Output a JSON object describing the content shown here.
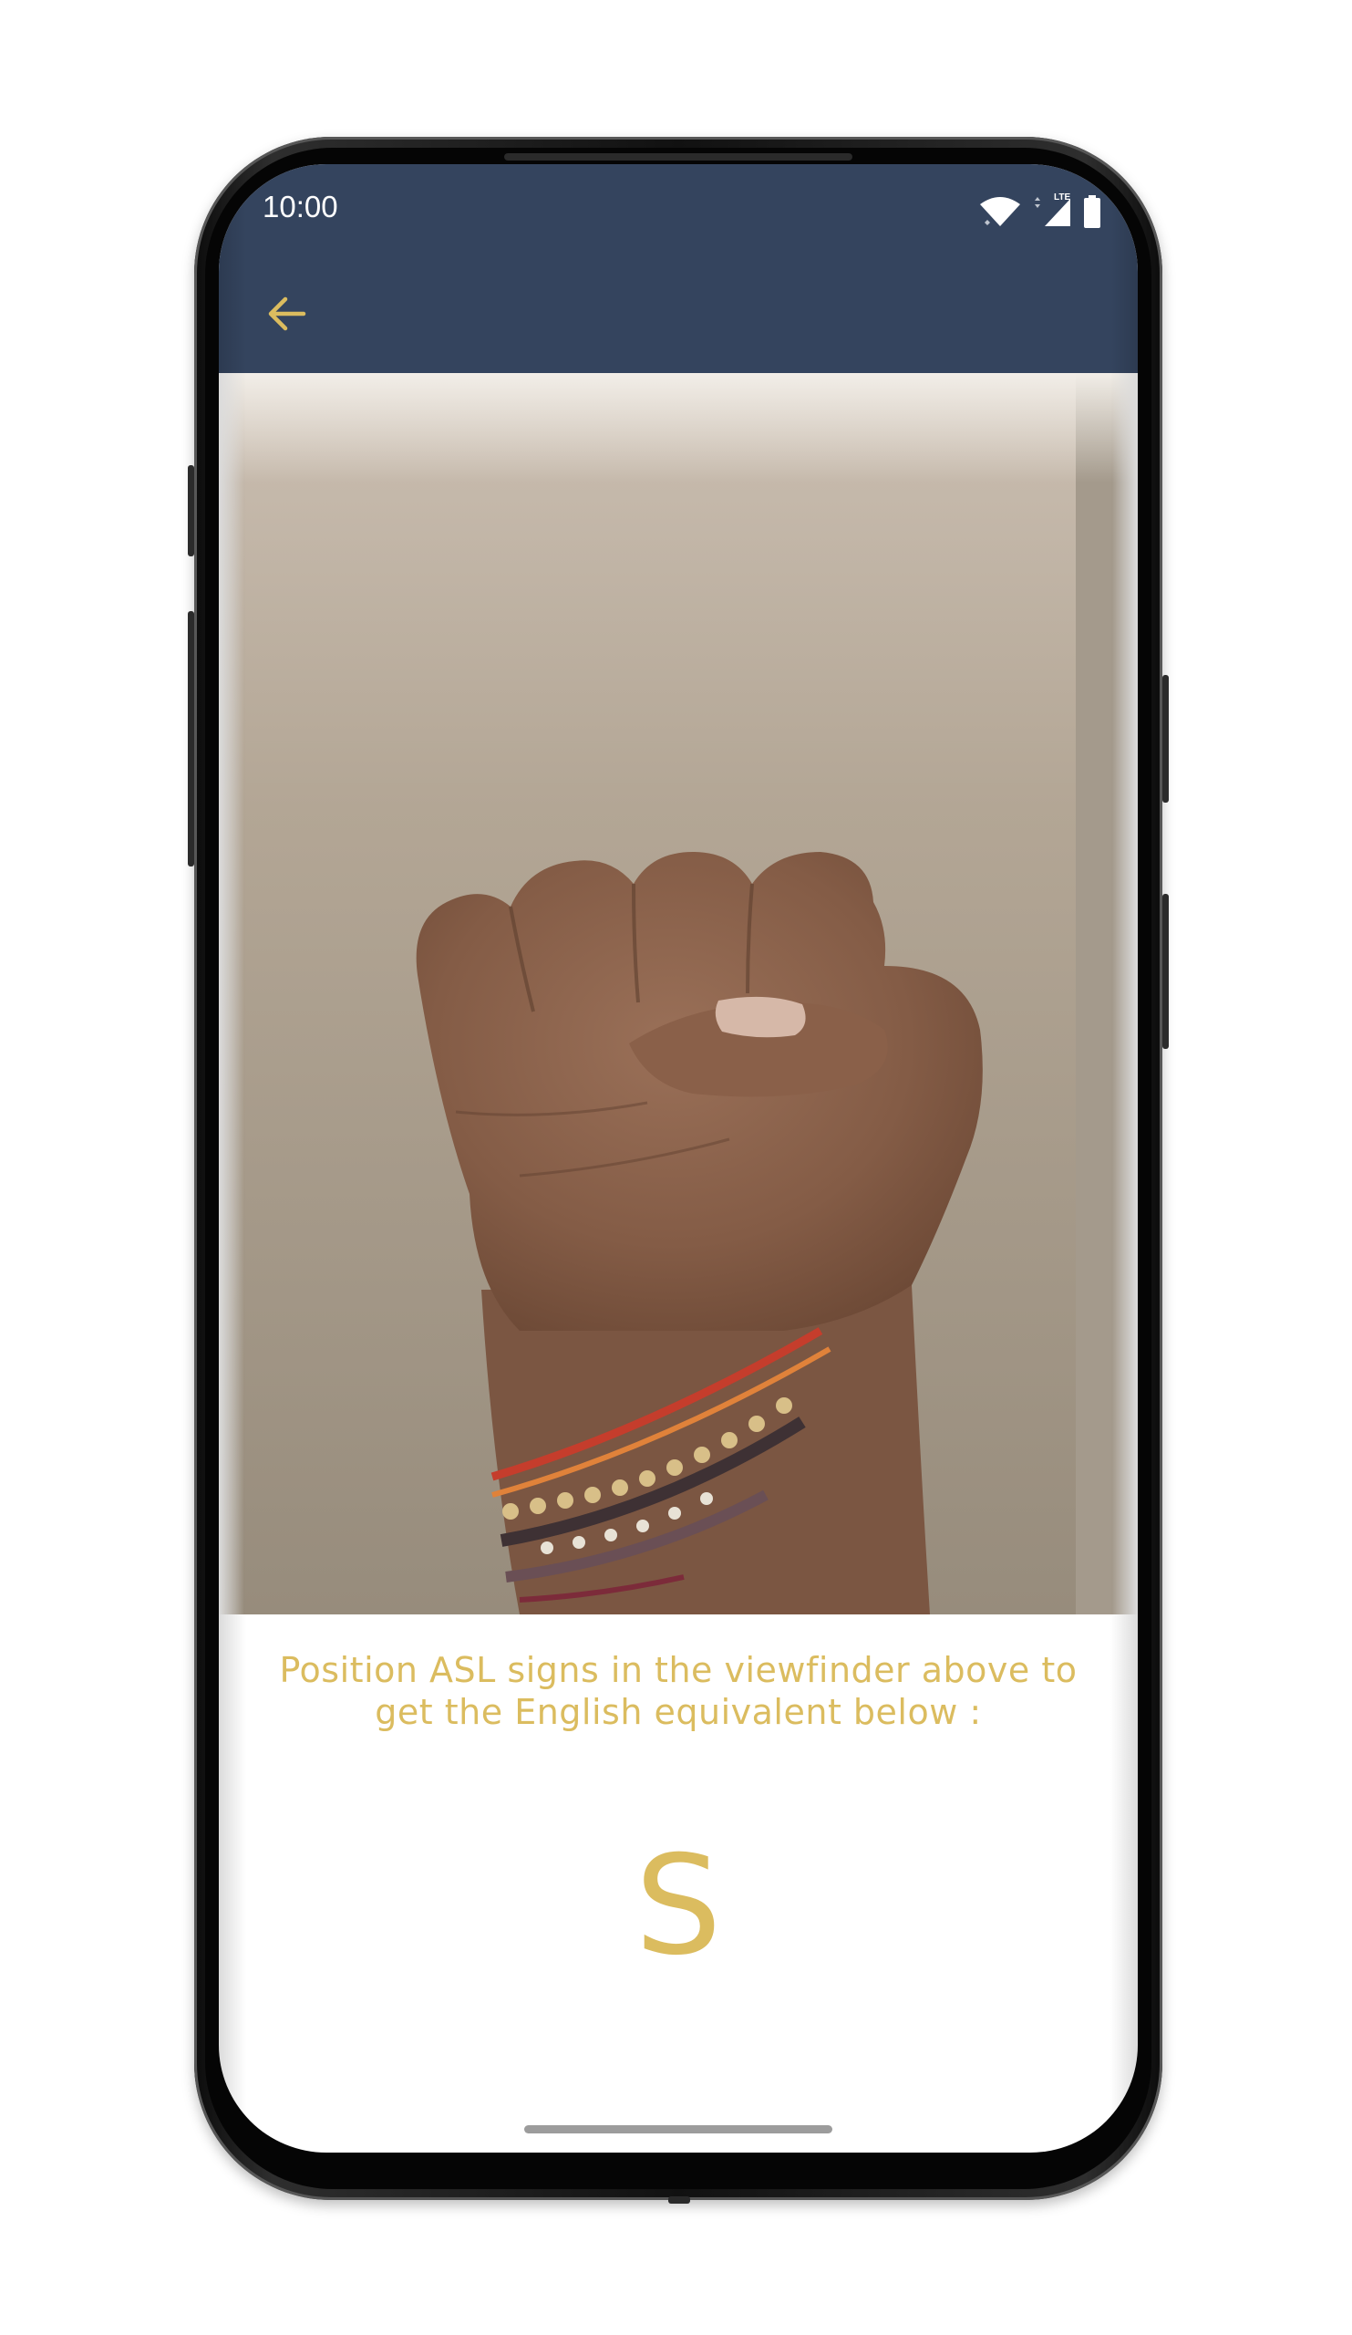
{
  "status_bar": {
    "time": "10:00",
    "network_label": "LTE",
    "icons": [
      "wifi-icon",
      "signal-icon",
      "battery-icon"
    ]
  },
  "toolbar": {
    "back_icon": "arrow-left-icon"
  },
  "viewfinder": {
    "content": "camera-feed"
  },
  "instructions": {
    "text": "Position ASL signs in the viewfinder above to get the English equivalent below :"
  },
  "result": {
    "letter": "S"
  },
  "colors": {
    "header": "#34445e",
    "accent": "#dbbc5f",
    "background": "#ffffff",
    "status_text": "#ffffff"
  }
}
